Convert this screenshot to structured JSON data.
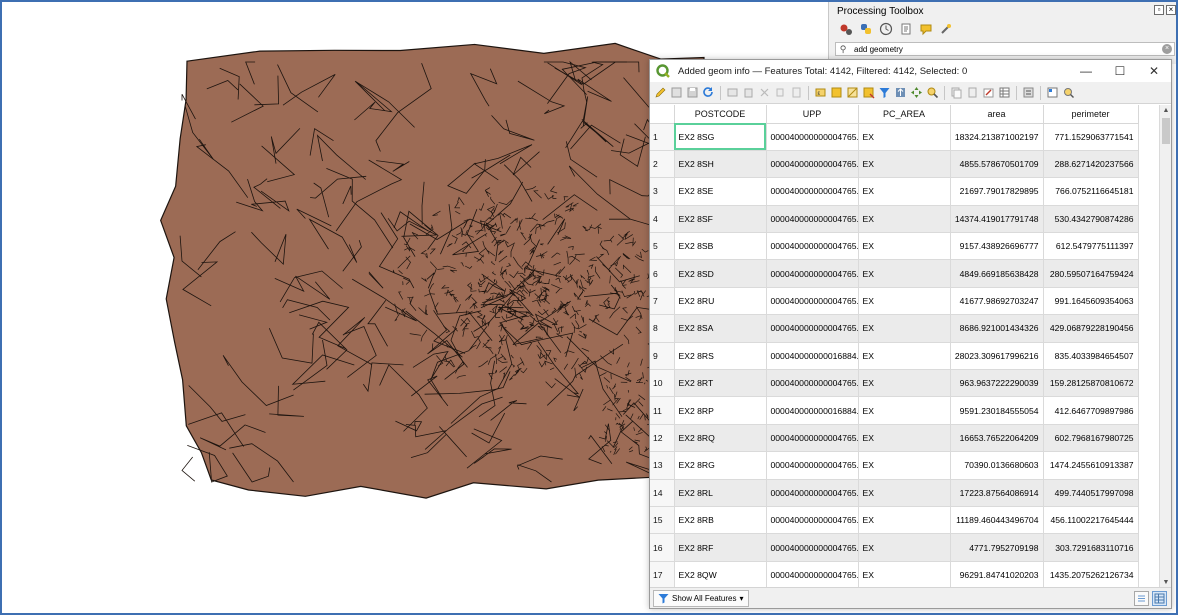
{
  "toolbox": {
    "title": "Processing Toolbox",
    "search_value": "add geometry"
  },
  "window": {
    "title": "Added geom info — Features Total: 4142, Filtered: 4142, Selected: 0",
    "minimize": "—",
    "maximize": "☐",
    "close": "✕"
  },
  "table": {
    "columns": [
      "POSTCODE",
      "UPP",
      "PC_AREA",
      "area",
      "perimeter"
    ],
    "rows": [
      [
        "1",
        "EX2 8SG",
        "000040000000004765...",
        "EX",
        "18324.213871002197",
        "771.1529063771541"
      ],
      [
        "2",
        "EX2 8SH",
        "000040000000004765...",
        "EX",
        "4855.578670501709",
        "288.6271420237566"
      ],
      [
        "3",
        "EX2 8SE",
        "000040000000004765...",
        "EX",
        "21697.79017829895",
        "766.0752116645181"
      ],
      [
        "4",
        "EX2 8SF",
        "000040000000004765...",
        "EX",
        "14374.419017791748",
        "530.4342790874286"
      ],
      [
        "5",
        "EX2 8SB",
        "000040000000004765...",
        "EX",
        "9157.438926696777",
        "612.5479775111397"
      ],
      [
        "6",
        "EX2 8SD",
        "000040000000004765...",
        "EX",
        "4849.669185638428",
        "280.59507164759424"
      ],
      [
        "7",
        "EX2 8RU",
        "000040000000004765...",
        "EX",
        "41677.98692703247",
        "991.1645609354063"
      ],
      [
        "8",
        "EX2 8SA",
        "000040000000004765...",
        "EX",
        "8686.921001434326",
        "429.06879228190456"
      ],
      [
        "9",
        "EX2 8RS",
        "000040000000016884...",
        "EX",
        "28023.309617996216",
        "835.4033984654507"
      ],
      [
        "10",
        "EX2 8RT",
        "000040000000004765...",
        "EX",
        "963.9637222290039",
        "159.28125870810672"
      ],
      [
        "11",
        "EX2 8RP",
        "000040000000016884...",
        "EX",
        "9591.230184555054",
        "412.6467709897986"
      ],
      [
        "12",
        "EX2 8RQ",
        "000040000000004765...",
        "EX",
        "16653.76522064209",
        "602.7968167980725"
      ],
      [
        "13",
        "EX2 8RG",
        "000040000000004765...",
        "EX",
        "70390.0136680603",
        "1474.2455610913387"
      ],
      [
        "14",
        "EX2 8RL",
        "000040000000004765...",
        "EX",
        "17223.87564086914",
        "499.7440517997098"
      ],
      [
        "15",
        "EX2 8RB",
        "000040000000004765...",
        "EX",
        "11189.460443496704",
        "456.11002217645444"
      ],
      [
        "16",
        "EX2 8RF",
        "000040000000004765...",
        "EX",
        "4771.7952709198",
        "303.7291683110716"
      ],
      [
        "17",
        "EX2 8QW",
        "000040000000004765...",
        "EX",
        "96291.84741020203",
        "1435.2075262126734"
      ]
    ]
  },
  "statusbar": {
    "show_all_label": "Show All Features"
  },
  "colors": {
    "polygon_fill": "#9c6b55",
    "polygon_stroke": "#1d140f",
    "selected_cell": "#5ad09a",
    "screen_border": "#3e6fb2"
  },
  "icons": {
    "toolbox": [
      "gears-icon",
      "python-icon",
      "history-icon",
      "results-icon",
      "comment-icon",
      "options-icon"
    ],
    "table_toolbar": [
      "edit-pencil-icon",
      "multi-edit-icon",
      "save-icon",
      "reload-icon",
      "add-feature-icon",
      "delete-feature-icon",
      "cut-icon",
      "copy-icon",
      "paste-icon",
      "expression-select-icon",
      "select-all-icon",
      "invert-selection-icon",
      "deselect-icon",
      "filter-icon",
      "move-top-icon",
      "pan-icon",
      "zoom-icon",
      "copy-rows-icon",
      "paste-rows-icon",
      "delete-field-icon",
      "new-field-icon",
      "field-calculator-icon",
      "conditional-format-icon",
      "dock-icon",
      "actions-icon"
    ]
  }
}
